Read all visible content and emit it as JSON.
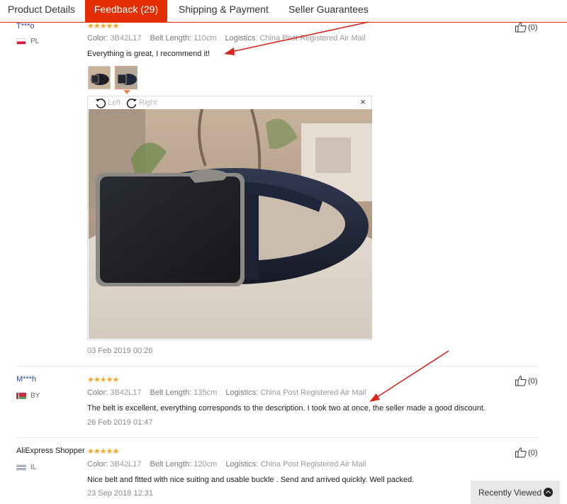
{
  "tabs": [
    {
      "label": "Product Details"
    },
    {
      "label": "Feedback (29)"
    },
    {
      "label": "Shipping & Payment"
    },
    {
      "label": "Seller Guarantees"
    }
  ],
  "meta_labels": {
    "color": "Color:",
    "belt_length": "Belt Length:",
    "logistics": "Logistics:"
  },
  "reviews": [
    {
      "user": "T***o",
      "country": "PL",
      "stars": "★★★★★",
      "color": "3B42L17",
      "belt_length": "110cm",
      "logistics": "China Post Registered Air Mail",
      "text": "Everything is great, I recommend it!",
      "date": "03 Feb 2019 00:26",
      "helpful": "(0)"
    },
    {
      "user": "M***h",
      "country": "BY",
      "stars": "★★★★★",
      "color": "3B42L17",
      "belt_length": "135cm",
      "logistics": "China Post Registered Air Mail",
      "text": "The belt is excellent, everything corresponds to the description. I took two at once, the seller made a good discount.",
      "date": "26 Feb 2019 01:47",
      "helpful": "(0)"
    },
    {
      "user": "AliExpress Shopper",
      "country": "IL",
      "stars": "★★★★★",
      "color": "3B42L17",
      "belt_length": "120cm",
      "logistics": "China Post Registered Air Mail",
      "text": "Nice belt and fitted with nice suiting and usable buckle . Send and arrived quickly. Well packed.",
      "date": "23 Sep 2018 12:31",
      "helpful": "(0)"
    }
  ],
  "viewer": {
    "rotate_left": "Left",
    "rotate_right": "Right",
    "close": "×"
  },
  "recently_viewed": "Recently Viewed",
  "colors": {
    "accent": "#e62e04",
    "star": "#f5a623",
    "arrow": "#d9261c"
  },
  "icons": [
    "thumbs-up-icon",
    "rotate-left-icon",
    "rotate-right-icon",
    "close-icon",
    "chevron-up-icon"
  ]
}
